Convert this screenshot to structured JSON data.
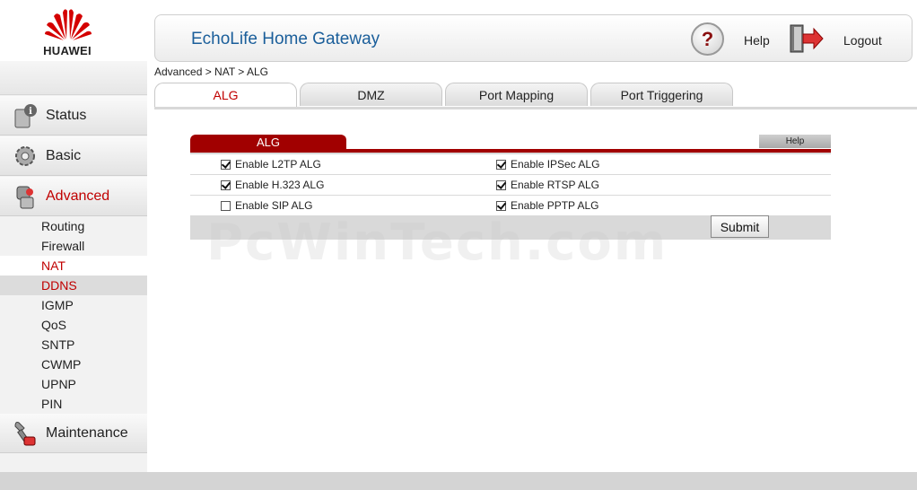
{
  "brand": {
    "logo_text": "HUAWEI",
    "accent": "#c00000",
    "panel_red": "#a10000"
  },
  "header": {
    "title": "EchoLife Home Gateway",
    "help_label": "Help",
    "logout_label": "Logout",
    "help_icon": "question-icon",
    "logout_icon": "door-exit-icon"
  },
  "breadcrumb": "Advanced > NAT > ALG",
  "sidebar": {
    "main_items": [
      {
        "label": "Status",
        "icon": "status-icon"
      },
      {
        "label": "Basic",
        "icon": "gear-icon"
      },
      {
        "label": "Advanced",
        "icon": "tools-icon",
        "active": true
      },
      {
        "label": "Maintenance",
        "icon": "wrench-icon"
      }
    ],
    "sub_items": [
      {
        "label": "Routing"
      },
      {
        "label": "Firewall"
      },
      {
        "label": "NAT",
        "selected": true
      },
      {
        "label": "DDNS",
        "hovered": true
      },
      {
        "label": "IGMP"
      },
      {
        "label": "QoS"
      },
      {
        "label": "SNTP"
      },
      {
        "label": "CWMP"
      },
      {
        "label": "UPNP"
      },
      {
        "label": "PIN"
      }
    ]
  },
  "tabs": [
    {
      "label": "ALG",
      "active": true
    },
    {
      "label": "DMZ"
    },
    {
      "label": "Port Mapping"
    },
    {
      "label": "Port Triggering"
    }
  ],
  "panel": {
    "title": "ALG",
    "help_label": "Help",
    "options": [
      [
        {
          "label": "Enable L2TP ALG",
          "checked": true
        },
        {
          "label": "Enable IPSec ALG",
          "checked": true
        }
      ],
      [
        {
          "label": "Enable H.323 ALG",
          "checked": true
        },
        {
          "label": "Enable RTSP ALG",
          "checked": true
        }
      ],
      [
        {
          "label": "Enable SIP ALG",
          "checked": false
        },
        {
          "label": "Enable PPTP ALG",
          "checked": true
        }
      ]
    ],
    "submit_label": "Submit"
  },
  "watermark": "PcWinTech.com"
}
